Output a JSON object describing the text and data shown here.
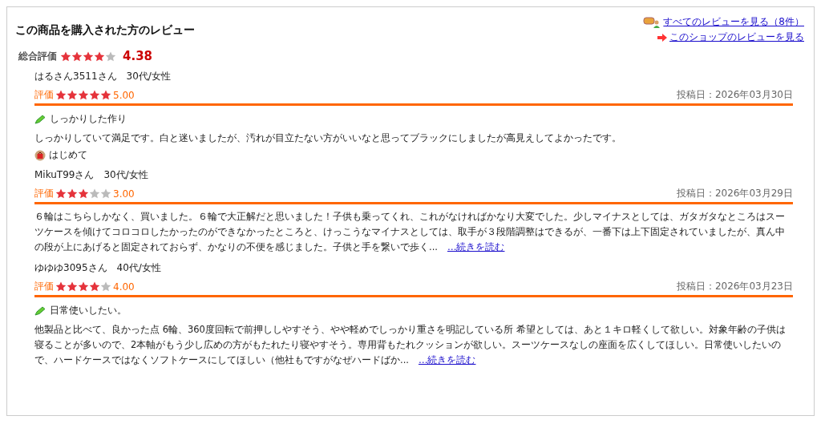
{
  "title": "この商品を購入された方のレビュー",
  "links": [
    {
      "kind": "all",
      "label": "すべてのレビューを見る（8件）"
    },
    {
      "kind": "shop",
      "label": "このショップのレビューを見る"
    }
  ],
  "overall": {
    "label": "総合評価",
    "stars": 4,
    "score": "4.38"
  },
  "reviews": [
    {
      "reviewer": "はるさん3511さん　30代/女性",
      "rating_label": "評価",
      "stars": 5,
      "score": "5.00",
      "date": "投稿日：2026年03月30日",
      "headline": "しっかりした作り",
      "body": "しっかりしていて満足です。白と迷いましたが、汚れが目立たない方がいいなと思ってブラックにしましたが高見えしてよかったです。",
      "tag": "はじめて"
    },
    {
      "reviewer": "MikuT99さん　30代/女性",
      "rating_label": "評価",
      "stars": 3,
      "score": "3.00",
      "date": "投稿日：2026年03月29日",
      "body": "６輪はこちらしかなく、買いました。６輪で大正解だと思いました！子供も乗ってくれ、これがなければかなり大変でした。少しマイナスとしては、ガタガタなところはスーツケースを傾けてコロコロしたかったのができなかったところと、けっこうなマイナスとしては、取手が３段階調整はできるが、一番下は上下固定されていましたが、真ん中の段が上にあげると固定されておらず、かなりの不便を感じました。子供と手を繋いで歩く...",
      "more": "…続きを読む"
    },
    {
      "reviewer": "ゆゆゆ3095さん　40代/女性",
      "rating_label": "評価",
      "stars": 4,
      "score": "4.00",
      "date": "投稿日：2026年03月23日",
      "headline": "日常使いしたい。",
      "body": "他製品と比べて、良かった点 6輪、360度回転で前押ししやすそう、やや軽めでしっかり重さを明記している所 希望としては、あと１キロ軽くして欲しい。対象年齢の子供は寝ることが多いので、2本軸がもう少し広めの方がもたれたり寝やすそう。専用背もたれクッションが欲しい。スーツケースなしの座面を広くしてほしい。日常使いしたいので、ハードケースではなくソフトケースにしてほしい（他社もですがなぜハードばか...",
      "more": "…続きを読む"
    }
  ]
}
